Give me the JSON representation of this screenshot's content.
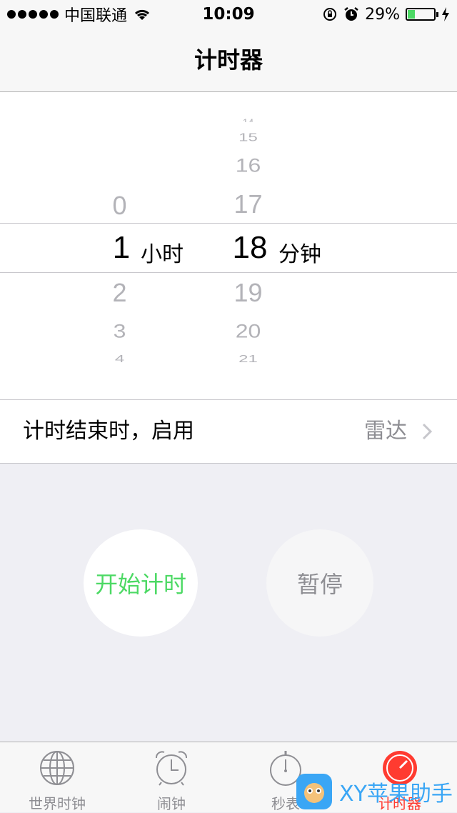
{
  "status": {
    "carrier": "中国联通",
    "time": "10:09",
    "battery_percent": "29%",
    "battery_level": 0.29,
    "battery_color": "#4cd964"
  },
  "nav": {
    "title": "计时器"
  },
  "picker": {
    "hours_above": [
      "0"
    ],
    "hours_selected": "1",
    "hours_unit": "小时",
    "hours_below": [
      "2",
      "3",
      "4"
    ],
    "minutes_above": [
      "14",
      "15",
      "16",
      "17"
    ],
    "minutes_selected": "18",
    "minutes_unit": "分钟",
    "minutes_below": [
      "19",
      "20",
      "21"
    ]
  },
  "row": {
    "label": "计时结束时，启用",
    "value": "雷达"
  },
  "buttons": {
    "start": "开始计时",
    "pause": "暂停",
    "start_color": "#4cd964"
  },
  "tabs": [
    {
      "label": "世界时钟",
      "icon": "globe-icon"
    },
    {
      "label": "闹钟",
      "icon": "alarm-clock-icon"
    },
    {
      "label": "秒表",
      "icon": "stopwatch-icon"
    },
    {
      "label": "计时器",
      "icon": "timer-icon",
      "active": true
    }
  ],
  "accent_color": "#ff3b30",
  "watermark": {
    "text": "XY苹果助手"
  }
}
